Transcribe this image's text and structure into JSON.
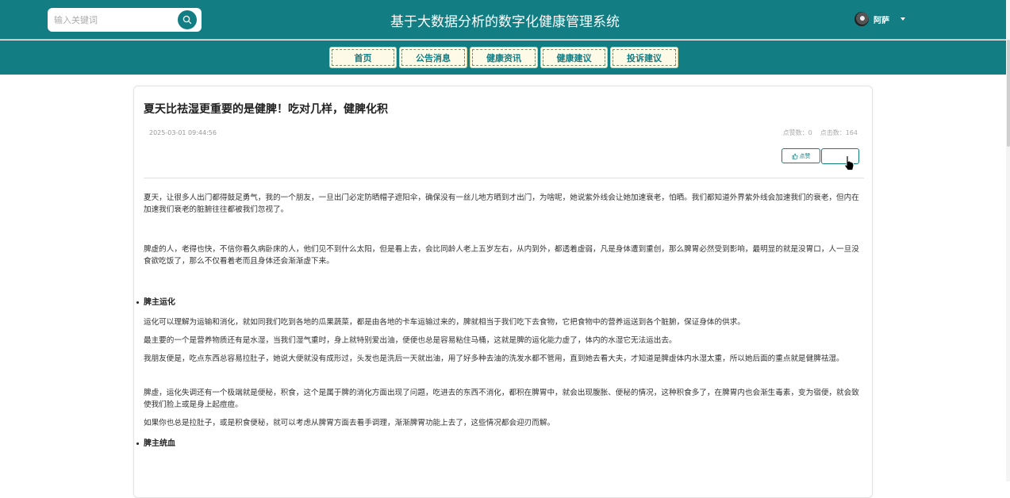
{
  "header": {
    "search_placeholder": "输入关键词",
    "site_title": "基于大数据分析的数字化健康管理系统",
    "username": "阿萨",
    "brand_color": "#127e84"
  },
  "nav": {
    "items": [
      {
        "label": "首页"
      },
      {
        "label": "公告消息"
      },
      {
        "label": "健康资讯"
      },
      {
        "label": "健康建议"
      },
      {
        "label": "投诉建议"
      }
    ]
  },
  "article": {
    "title": "夏天比祛湿更重要的是健脾！吃对几样，健脾化积",
    "date": "2025-03-01 09:44:56",
    "likes_text": "点赞数：0",
    "clicks_text": "点击数：164",
    "like_button": "点赞",
    "fav_button": "",
    "paragraphs": {
      "p1": "夏天，让很多人出门都得鼓足勇气，我的一个朋友，一旦出门必定防晒帽子遮阳伞，确保没有一丝儿地方晒到才出门，为啥呢，她说紫外线会让她加速衰老，怕晒。我们都知道外界紫外线会加速我们的衰老，但内在加速我们衰老的脏腑往往都被我们忽视了。",
      "p2": "脾虚的人，老得也快，不信你看久病卧床的人，他们见不到什么太阳，但是看上去，会比同龄人老上五岁左右，从内到外，都透着虚弱，凡是身体遭到重创，那么脾胃必然受到影响，最明显的就是没胃口，人一旦没食欲吃饭了，那么不仅看着老而且身体还会渐渐虚下来。",
      "h1": "脾主运化",
      "p3": "运化可以理解为运输和消化，就如同我们吃到各地的瓜果蔬菜，都是由各地的卡车运输过来的，脾就相当于我们吃下去食物，它把食物中的营养运送到各个脏腑，保证身体的供求。",
      "p4": "最主要的一个是营养物质还有是水湿，当我们湿气重时，身上就特别爱出油，便便也总是容易粘住马桶，这就是脾的运化能力虚了，体内的水湿它无法运出去。",
      "p5": "我朋友便是，吃点东西总容易拉肚子，她说大便就没有成形过，头发也是洗后一天就出油，用了好多种去油的洗发水都不管用，直到她去看大夫，才知道是脾虚体内水湿太重，所以她后面的重点就是健脾祛湿。",
      "p6": "脾虚，运化失调还有一个极端就是便秘，积食，这个是属于脾的消化方面出现了问题，吃进去的东西不消化，都积在脾胃中，就会出现腹胀、便秘的情况，这种积食多了，在脾胃内也会渐生毒素，变为宿便，就会致使我们脸上或是身上起痘痘。",
      "p7": "如果你也总是拉肚子，或是积食便秘，就可以考虑从脾胃方面去看手调理，渐渐脾胃功能上去了，这些情况都会迎刃而解。",
      "h2": "脾主统血"
    }
  }
}
